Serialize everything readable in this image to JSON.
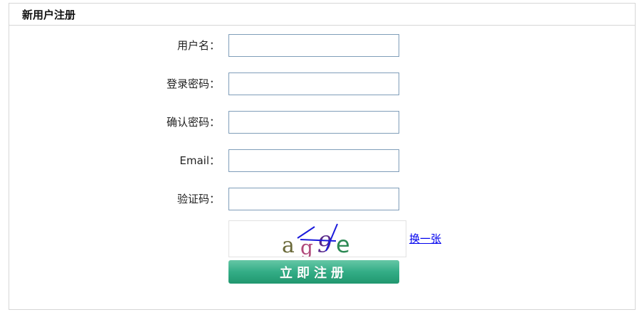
{
  "form": {
    "title": "新用户注册",
    "fields": {
      "username": {
        "label": "用户名：",
        "value": ""
      },
      "password": {
        "label": "登录密码：",
        "value": ""
      },
      "confirm_password": {
        "label": "确认密码：",
        "value": ""
      },
      "email": {
        "label": "Email：",
        "value": ""
      },
      "captcha": {
        "label": "验证码：",
        "value": ""
      }
    },
    "captcha_image": {
      "text": "ag9e"
    },
    "refresh_link": "换一张",
    "submit_label": "立即注册"
  },
  "colors": {
    "panel_border": "#d6d6d6",
    "input_border": "#7f9db9",
    "button_top": "#66c7a6",
    "button_bottom": "#21976f",
    "link": "#0000ee"
  }
}
